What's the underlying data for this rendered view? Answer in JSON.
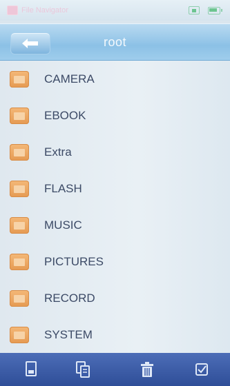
{
  "status_bar": {
    "app_title": "File Navigator",
    "icons": [
      "media-icon",
      "battery-icon"
    ]
  },
  "nav": {
    "back_icon": "back-arrow-icon",
    "title": "root"
  },
  "folders": [
    {
      "label": "CAMERA"
    },
    {
      "label": "EBOOK"
    },
    {
      "label": "Extra"
    },
    {
      "label": "FLASH"
    },
    {
      "label": "MUSIC"
    },
    {
      "label": "PICTURES"
    },
    {
      "label": "RECORD"
    },
    {
      "label": "SYSTEM"
    }
  ],
  "toolbar": {
    "buttons": [
      "open-icon",
      "copy-icon",
      "delete-icon",
      "select-icon"
    ]
  },
  "colors": {
    "nav_bar": "#9fcdec",
    "toolbar": "#3b5ca8",
    "folder": "#eaa662",
    "label_text": "#3c4a66"
  }
}
